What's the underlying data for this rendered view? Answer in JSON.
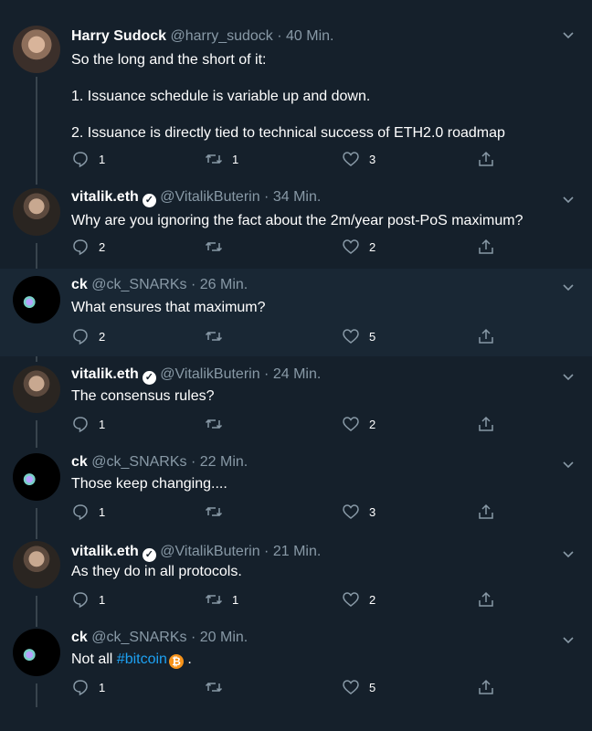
{
  "tweets": [
    {
      "name": "Harry Sudock",
      "handle": "@harry_sudock",
      "dot": "·",
      "time": "40 Min.",
      "verified": false,
      "lines": [
        "So the long and the short of it:",
        "",
        "1. Issuance schedule is variable up and down.",
        "",
        "2. Issuance is directly tied to technical success of ETH2.0 roadmap"
      ],
      "replies": "1",
      "retweets": "1",
      "likes": "3",
      "avatar": "harry"
    },
    {
      "name": "vitalik.eth",
      "handle": "@VitalikButerin",
      "dot": "·",
      "time": "34 Min.",
      "verified": true,
      "lines": [
        "Why are you ignoring the fact about the 2m/year post-PoS maximum?"
      ],
      "replies": "2",
      "retweets": "",
      "likes": "2",
      "avatar": "vitalik"
    },
    {
      "name": "ck",
      "handle": "@ck_SNARKs",
      "dot": "·",
      "time": "26 Min.",
      "verified": false,
      "lines": [
        "What ensures that maximum?"
      ],
      "replies": "2",
      "retweets": "",
      "likes": "5",
      "avatar": "ck"
    },
    {
      "name": "vitalik.eth",
      "handle": "@VitalikButerin",
      "dot": "·",
      "time": "24 Min.",
      "verified": true,
      "lines": [
        "The consensus rules?"
      ],
      "replies": "1",
      "retweets": "",
      "likes": "2",
      "avatar": "vitalik"
    },
    {
      "name": "ck",
      "handle": "@ck_SNARKs",
      "dot": "·",
      "time": "22 Min.",
      "verified": false,
      "lines": [
        "Those keep changing...."
      ],
      "replies": "1",
      "retweets": "",
      "likes": "3",
      "avatar": "ck"
    },
    {
      "name": "vitalik.eth",
      "handle": "@VitalikButerin",
      "dot": "·",
      "time": "21 Min.",
      "verified": true,
      "lines": [
        "As they do in all protocols."
      ],
      "replies": "1",
      "retweets": "1",
      "likes": "2",
      "avatar": "vitalik"
    },
    {
      "name": "ck",
      "handle": "@ck_SNARKs",
      "dot": "·",
      "time": "20 Min.",
      "verified": false,
      "lines": [],
      "text_prefix": "Not all ",
      "hashtag": "#bitcoin",
      "text_suffix": " .",
      "replies": "1",
      "retweets": "",
      "likes": "5",
      "avatar": "ck"
    }
  ],
  "colors": {
    "background": "#15202b",
    "highlight": "#192734",
    "icon": "#8899a6",
    "link": "#1da1f2",
    "bitcoin": "#f7931a"
  },
  "icons": {
    "reply": "speech-bubble-icon",
    "retweet": "retweet-arrows-icon",
    "like": "heart-icon",
    "share": "share-upload-icon",
    "more": "chevron-down-icon",
    "verified": "verified-check-icon",
    "bitcoin": "bitcoin-emoji-icon"
  }
}
